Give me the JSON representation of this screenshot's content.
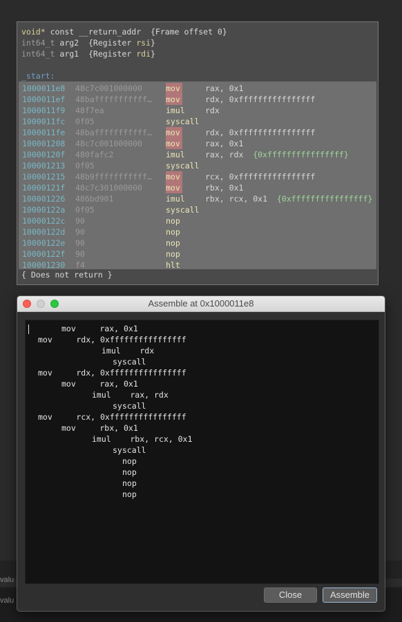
{
  "background_app": {
    "label_fragment": "valu"
  },
  "disassembly": {
    "header": [
      {
        "type": "void*",
        "kw": "const",
        "name": "__return_addr",
        "note": "{Frame offset 0}"
      },
      {
        "type": "int64_t",
        "name": "arg2",
        "note_pre": "{Register ",
        "reg": "rsi",
        "note_post": "}"
      },
      {
        "type": "int64_t",
        "name": "arg1",
        "note_pre": "{Register ",
        "reg": "rdi",
        "note_post": "}"
      }
    ],
    "label": "_start:",
    "instructions": [
      {
        "addr": "1000011e8",
        "bytes": "48c7c001000000",
        "mn": "mov",
        "hl": true,
        "ops": "rax, 0x1",
        "cmt": ""
      },
      {
        "addr": "1000011ef",
        "bytes": "48bafffffffffff…",
        "mn": "mov",
        "hl": true,
        "ops": "rdx, 0xffffffffffffffff",
        "cmt": ""
      },
      {
        "addr": "1000011f9",
        "bytes": "48f7ea",
        "mn": "imul",
        "hl": false,
        "ops": "rdx",
        "cmt": ""
      },
      {
        "addr": "1000011fc",
        "bytes": "0f05",
        "mn": "syscall",
        "hl": false,
        "ops": "",
        "cmt": ""
      },
      {
        "addr": "1000011fe",
        "bytes": "48bafffffffffff…",
        "mn": "mov",
        "hl": true,
        "ops": "rdx, 0xffffffffffffffff",
        "cmt": ""
      },
      {
        "addr": "100001208",
        "bytes": "48c7c001000000",
        "mn": "mov",
        "hl": true,
        "ops": "rax, 0x1",
        "cmt": ""
      },
      {
        "addr": "10000120f",
        "bytes": "480fafc2",
        "mn": "imul",
        "hl": false,
        "ops": "rax, rdx  ",
        "cmt": "{0xffffffffffffffff}"
      },
      {
        "addr": "100001213",
        "bytes": "0f05",
        "mn": "syscall",
        "hl": false,
        "ops": "",
        "cmt": ""
      },
      {
        "addr": "100001215",
        "bytes": "48b9fffffffffff…",
        "mn": "mov",
        "hl": true,
        "ops": "rcx, 0xffffffffffffffff",
        "cmt": ""
      },
      {
        "addr": "10000121f",
        "bytes": "48c7c301000000",
        "mn": "mov",
        "hl": true,
        "ops": "rbx, 0x1",
        "cmt": ""
      },
      {
        "addr": "100001226",
        "bytes": "486bd901",
        "mn": "imul",
        "hl": false,
        "ops": "rbx, rcx, 0x1  ",
        "cmt": "{0xffffffffffffffff}"
      },
      {
        "addr": "10000122a",
        "bytes": "0f05",
        "mn": "syscall",
        "hl": false,
        "ops": "",
        "cmt": ""
      },
      {
        "addr": "10000122c",
        "bytes": "90",
        "mn": "nop",
        "hl": false,
        "ops": "",
        "cmt": ""
      },
      {
        "addr": "10000122d",
        "bytes": "90",
        "mn": "nop",
        "hl": false,
        "ops": "",
        "cmt": ""
      },
      {
        "addr": "10000122e",
        "bytes": "90",
        "mn": "nop",
        "hl": false,
        "ops": "",
        "cmt": ""
      },
      {
        "addr": "10000122f",
        "bytes": "90",
        "mn": "nop",
        "hl": false,
        "ops": "",
        "cmt": ""
      },
      {
        "addr": "100001230",
        "bytes": "f4",
        "mn": "hlt",
        "hl": false,
        "ops": "",
        "cmt": ""
      }
    ],
    "footer": "{ Does not return }"
  },
  "assemble_window": {
    "title": "Assemble at 0x1000011e8",
    "lines": [
      "mov     rax, 0x1",
      "mov     rdx, 0xffffffffffffffff",
      "imul    rdx",
      "syscall",
      "mov     rdx, 0xffffffffffffffff",
      "mov     rax, 0x1",
      "imul    rax, rdx",
      "syscall",
      "mov     rcx, 0xffffffffffffffff",
      "mov     rbx, 0x1",
      "imul    rbx, rcx, 0x1",
      "syscall",
      "nop",
      "nop",
      "nop",
      "nop"
    ],
    "close_label": "Close",
    "assemble_label": "Assemble"
  }
}
